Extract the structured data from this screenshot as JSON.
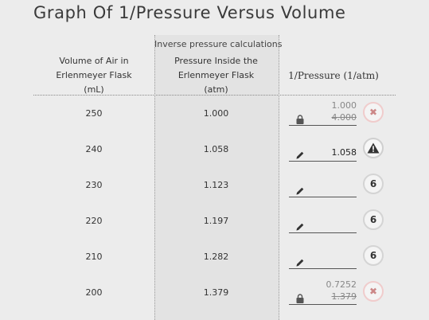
{
  "title": "Graph Of 1/Pressure Versus Volume",
  "table": {
    "group_label": "Inverse pressure calculations",
    "headers": {
      "volume": "Volume of Air in Erlenmeyer Flask (mL)",
      "pressure": "Pressure Inside the Erlenmeyer Flask (atm)",
      "inverse": "1/Pressure (1/atm)"
    },
    "rows": [
      {
        "volume": "250",
        "pressure": "1.000",
        "input_state": "locked",
        "input_icon": "lock-icon",
        "corrected_value": "1.000",
        "entered_value": "4.000",
        "badge_state": "incorrect",
        "badge_icon": "x-icon",
        "badge_text": "✖"
      },
      {
        "volume": "240",
        "pressure": "1.058",
        "input_state": "editable",
        "input_icon": "pencil-icon",
        "entered_value": "1.058",
        "badge_state": "warning",
        "badge_icon": "warning-icon",
        "badge_text": ""
      },
      {
        "volume": "230",
        "pressure": "1.123",
        "input_state": "editable",
        "input_icon": "pencil-icon",
        "entered_value": "",
        "badge_state": "attempts",
        "badge_text": "6"
      },
      {
        "volume": "220",
        "pressure": "1.197",
        "input_state": "editable",
        "input_icon": "pencil-icon",
        "entered_value": "",
        "badge_state": "attempts",
        "badge_text": "6"
      },
      {
        "volume": "210",
        "pressure": "1.282",
        "input_state": "editable",
        "input_icon": "pencil-icon",
        "entered_value": "",
        "badge_state": "attempts",
        "badge_text": "6"
      },
      {
        "volume": "200",
        "pressure": "1.379",
        "input_state": "locked",
        "input_icon": "lock-icon",
        "corrected_value": "0.7252",
        "entered_value": "1.379",
        "badge_state": "incorrect",
        "badge_icon": "x-icon",
        "badge_text": "✖"
      }
    ]
  }
}
